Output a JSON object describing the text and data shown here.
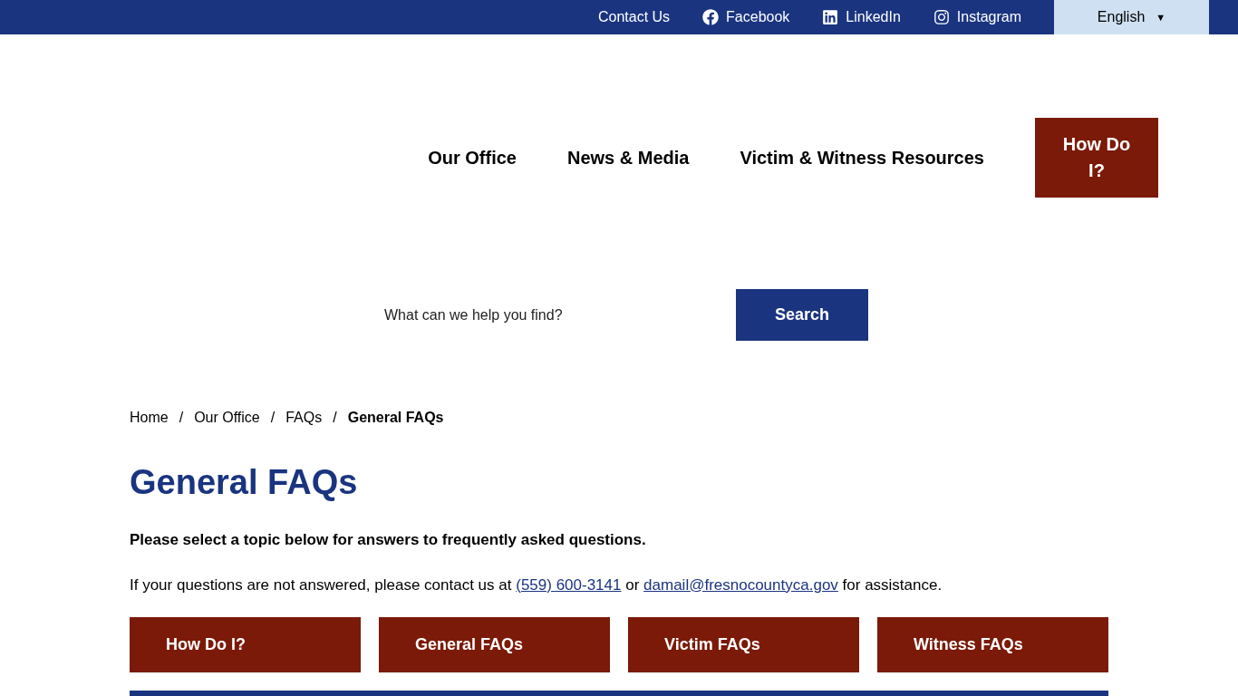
{
  "top_bar": {
    "links": [
      {
        "label": "Contact Us",
        "kind": "text"
      },
      {
        "label": "Facebook",
        "kind": "facebook"
      },
      {
        "label": "LinkedIn",
        "kind": "linkedin"
      },
      {
        "label": "Instagram",
        "kind": "instagram"
      }
    ],
    "language": {
      "value": "English",
      "caret": "▼"
    }
  },
  "nav": {
    "items": [
      {
        "label": "Our Office",
        "kind": "link"
      },
      {
        "label": "News & Media",
        "kind": "link"
      },
      {
        "label": "Victim & Witness Resources",
        "kind": "link"
      },
      {
        "label": "How Do I?",
        "kind": "button"
      }
    ]
  },
  "search": {
    "placeholder": "What can we help you find?",
    "button": "Search"
  },
  "breadcrumb": [
    {
      "label": "Home",
      "current": false
    },
    {
      "label": "Our Office",
      "current": false
    },
    {
      "label": "FAQs",
      "current": false
    },
    {
      "label": "General FAQs",
      "current": true
    }
  ],
  "breadcrumb_separator": "/",
  "title": "General FAQs",
  "intro": "Please select a topic below for answers to frequently asked questions.",
  "contact": {
    "before": "If your questions are not answered, please contact us at",
    "phone": "(559) 600-3141",
    "middle": "or",
    "email": "damail@fresnocountyca.gov",
    "after": "for assistance."
  },
  "topics": [
    "How Do I?",
    "General FAQs",
    "Victim FAQs",
    "Witness FAQs"
  ]
}
